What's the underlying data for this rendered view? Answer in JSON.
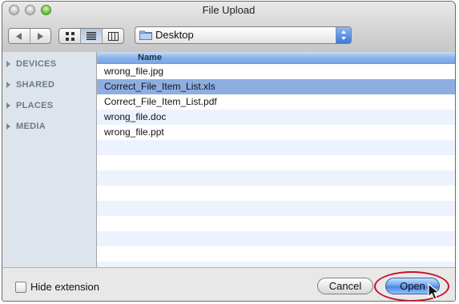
{
  "window": {
    "title": "File Upload"
  },
  "toolbar": {
    "back_icon": "back-arrow-icon",
    "forward_icon": "forward-arrow-icon",
    "view_icons": [
      "icon-view-icon",
      "list-view-icon",
      "column-view-icon"
    ],
    "active_view": "list-view-icon",
    "location": "Desktop"
  },
  "sidebar": {
    "items": [
      {
        "label": "DEVICES"
      },
      {
        "label": "SHARED"
      },
      {
        "label": "PLACES"
      },
      {
        "label": "MEDIA"
      }
    ]
  },
  "file_list": {
    "column_header": "Name",
    "files": [
      {
        "name": "wrong_file.jpg",
        "selected": false
      },
      {
        "name": "Correct_File_Item_List.xls",
        "selected": true
      },
      {
        "name": "Correct_File_Item_List.pdf",
        "selected": false
      },
      {
        "name": "wrong_file.doc",
        "selected": false
      },
      {
        "name": "wrong_file.ppt",
        "selected": false
      }
    ]
  },
  "footer": {
    "hide_extension_label": "Hide extension",
    "hide_extension_checked": false,
    "cancel_label": "Cancel",
    "open_label": "Open"
  },
  "colors": {
    "selection": "#8eaee2",
    "highlight_ring": "#c8102e",
    "default_button": "#4a86e0"
  }
}
